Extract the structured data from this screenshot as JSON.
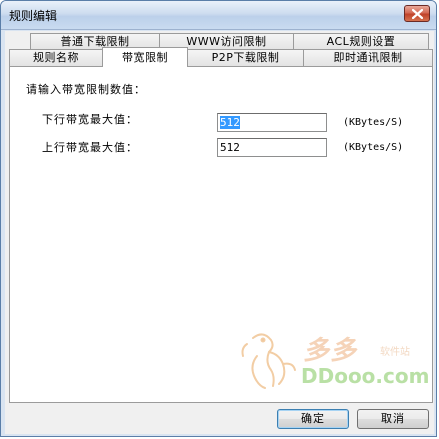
{
  "window": {
    "title": "规则编辑"
  },
  "tabs": {
    "row_back": [
      "普通下载限制",
      "WWW访问限制",
      "ACL规则设置"
    ],
    "row_front": [
      "规则名称",
      "带宽限制",
      "P2P下载限制",
      "即时通讯限制"
    ],
    "active": "带宽限制"
  },
  "bandwidth": {
    "prompt": "请输入带宽限制数值：",
    "download_label": "下行带宽最大值：",
    "download_value": "512",
    "download_unit": "(KBytes/S)",
    "upload_label": "上行带宽最大值：",
    "upload_value": "512",
    "upload_unit": "(KBytes/S)"
  },
  "watermark": {
    "cn": "多多",
    "cn_sub": "软件站",
    "en": "DDooo.com"
  },
  "buttons": {
    "ok": "确定",
    "cancel": "取消"
  },
  "icons": {
    "close": "close-icon",
    "watermark_logo": "horse-logo-icon"
  }
}
